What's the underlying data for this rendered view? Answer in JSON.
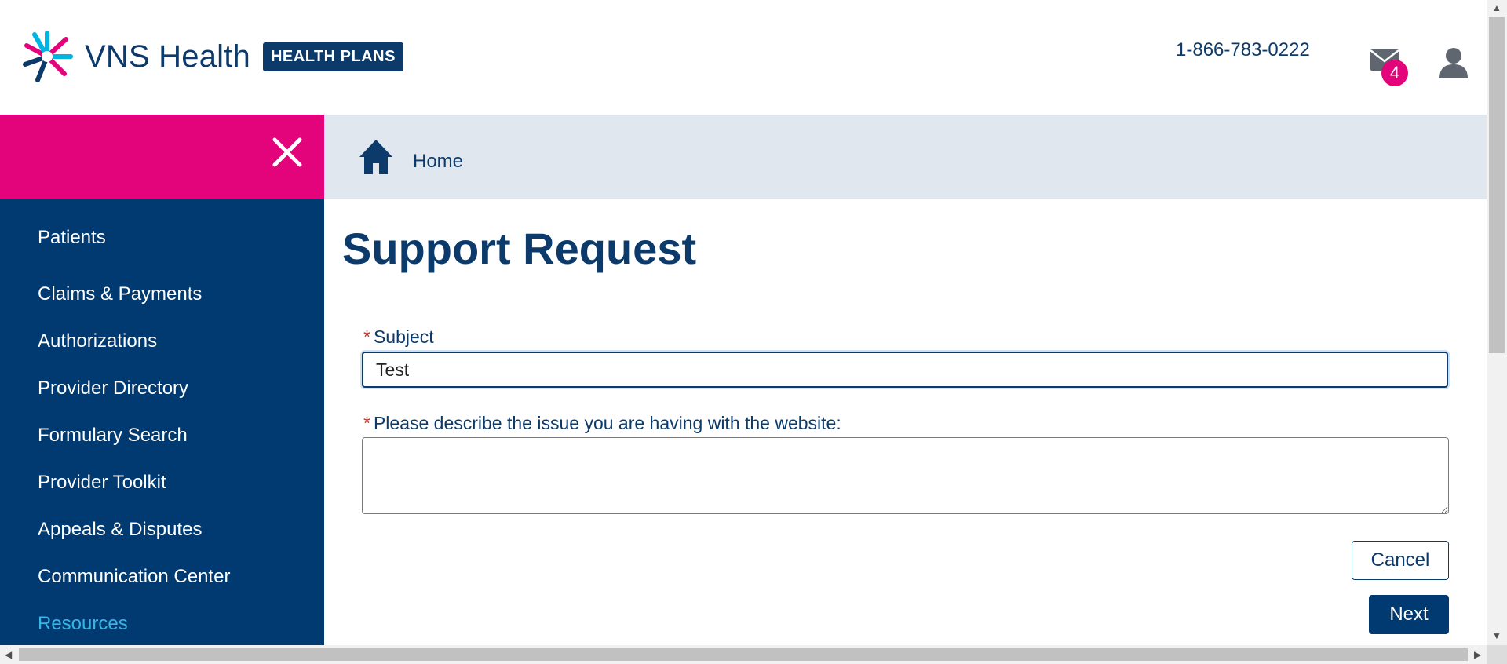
{
  "header": {
    "brand": "VNS Health",
    "plans_badge": "HEALTH PLANS",
    "phone": "1-866-783-0222",
    "mail_count": "4"
  },
  "sidebar": {
    "items": [
      {
        "label": "Patients"
      },
      {
        "label": "Claims & Payments"
      },
      {
        "label": "Authorizations"
      },
      {
        "label": "Provider Directory"
      },
      {
        "label": "Formulary Search"
      },
      {
        "label": "Provider Toolkit"
      },
      {
        "label": "Appeals & Disputes"
      },
      {
        "label": "Communication Center"
      },
      {
        "label": "Resources"
      }
    ]
  },
  "breadcrumb": {
    "home": "Home"
  },
  "main": {
    "title": "Support Request",
    "subject_label": "Subject",
    "subject_value": "Test",
    "issue_label": "Please describe the issue you are having with the website:",
    "issue_value": "",
    "cancel_label": "Cancel",
    "next_label": "Next"
  },
  "colors": {
    "brand_navy": "#003a70",
    "accent_pink": "#e3037b",
    "active_link": "#39b4e6",
    "breadcrumb_bg": "#e1e7ee"
  }
}
